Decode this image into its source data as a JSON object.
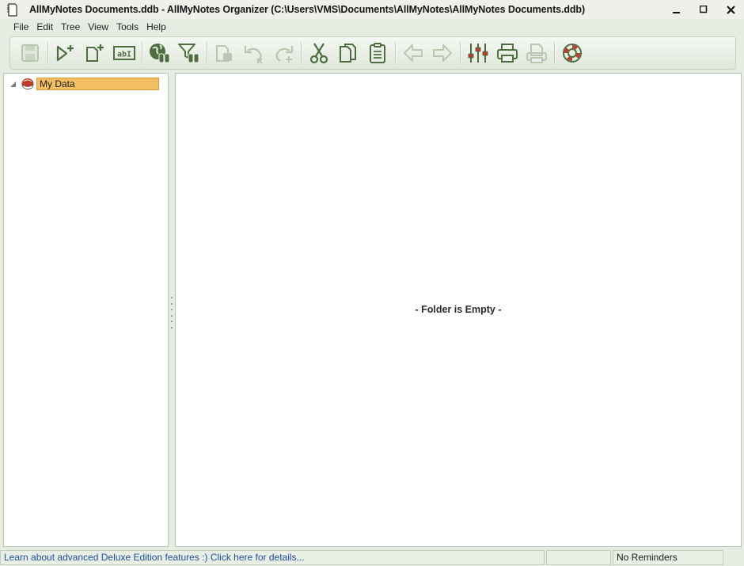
{
  "window": {
    "title": "AllMyNotes Documents.ddb - AllMyNotes Organizer (C:\\Users\\VMS\\Documents\\AllMyNotes\\AllMyNotes Documents.ddb)",
    "icon": "notebook-icon",
    "controls": [
      "minimize-icon",
      "maximize-icon",
      "close-icon"
    ]
  },
  "menu": {
    "items": [
      "File",
      "Edit",
      "Tree",
      "View",
      "Tools",
      "Help"
    ]
  },
  "toolbar": {
    "buttons": [
      {
        "icon": "save-icon",
        "enabled": false
      },
      {
        "icon": "new-folder-icon",
        "enabled": true
      },
      {
        "icon": "new-note-icon",
        "enabled": true
      },
      {
        "icon": "rename-icon",
        "enabled": true
      },
      {
        "icon": "global-search-icon",
        "enabled": true
      },
      {
        "icon": "filter-search-icon",
        "enabled": true
      },
      {
        "icon": "find-in-note-icon",
        "enabled": false
      },
      {
        "icon": "undo-icon",
        "enabled": false
      },
      {
        "icon": "redo-icon",
        "enabled": false
      },
      {
        "icon": "cut-icon",
        "enabled": true
      },
      {
        "icon": "copy-icon",
        "enabled": true
      },
      {
        "icon": "paste-icon",
        "enabled": true
      },
      {
        "icon": "back-icon",
        "enabled": false
      },
      {
        "icon": "forward-icon",
        "enabled": false
      },
      {
        "icon": "settings-sliders-icon",
        "enabled": true
      },
      {
        "icon": "print-icon",
        "enabled": true
      },
      {
        "icon": "print-preview-icon",
        "enabled": false
      },
      {
        "icon": "help-lifebuoy-icon",
        "enabled": true
      }
    ]
  },
  "tree": {
    "root": {
      "label": "My Data",
      "icon": "database-icon",
      "expanded": true,
      "selected": true
    }
  },
  "content": {
    "empty_message": "- Folder is Empty -"
  },
  "status": {
    "promo_link": "Learn about advanced Deluxe Edition features :) Click here for details...",
    "middle": "",
    "reminders": "No Reminders"
  },
  "colors": {
    "accent_green": "#6e8f5a",
    "selection_orange": "#f4bf62",
    "link_blue": "#1f4fa0"
  }
}
